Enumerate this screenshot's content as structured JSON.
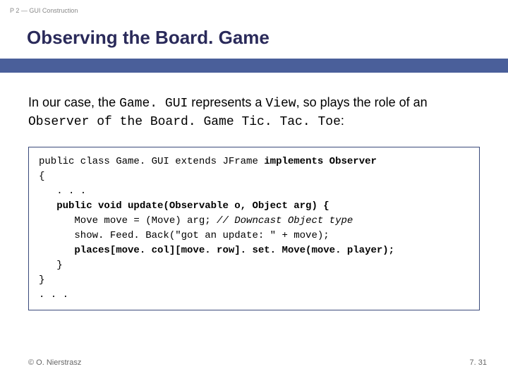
{
  "breadcrumb": "P 2 — GUI Construction",
  "title": "Observing the Board. Game",
  "intro": {
    "t1": "In our case, the ",
    "c1": "Game. GUI",
    "t2": " represents a ",
    "c2": "View",
    "t3": ", so plays the role of an ",
    "c3": "Observer of the Board. Game Tic. Tac. Toe",
    "t4": ":"
  },
  "code": {
    "l1a": "public class Game. GUI extends JFrame ",
    "l1b": "implements Observer",
    "l2": "{",
    "l3": "   . . .",
    "l4": "   public void update(Observable o, Object arg) {",
    "l5a": "      Move move = (Move) arg; ",
    "l5b": "// Downcast Object type",
    "l6": "      show. Feed. Back(\"got an update: \" + move);",
    "l7": "      places[move. col][move. row]. set. Move(move. player);",
    "l8": "   }",
    "l9": "}",
    "l10": ". . ."
  },
  "footer": {
    "left": "© O. Nierstrasz",
    "right": "7. 31"
  }
}
